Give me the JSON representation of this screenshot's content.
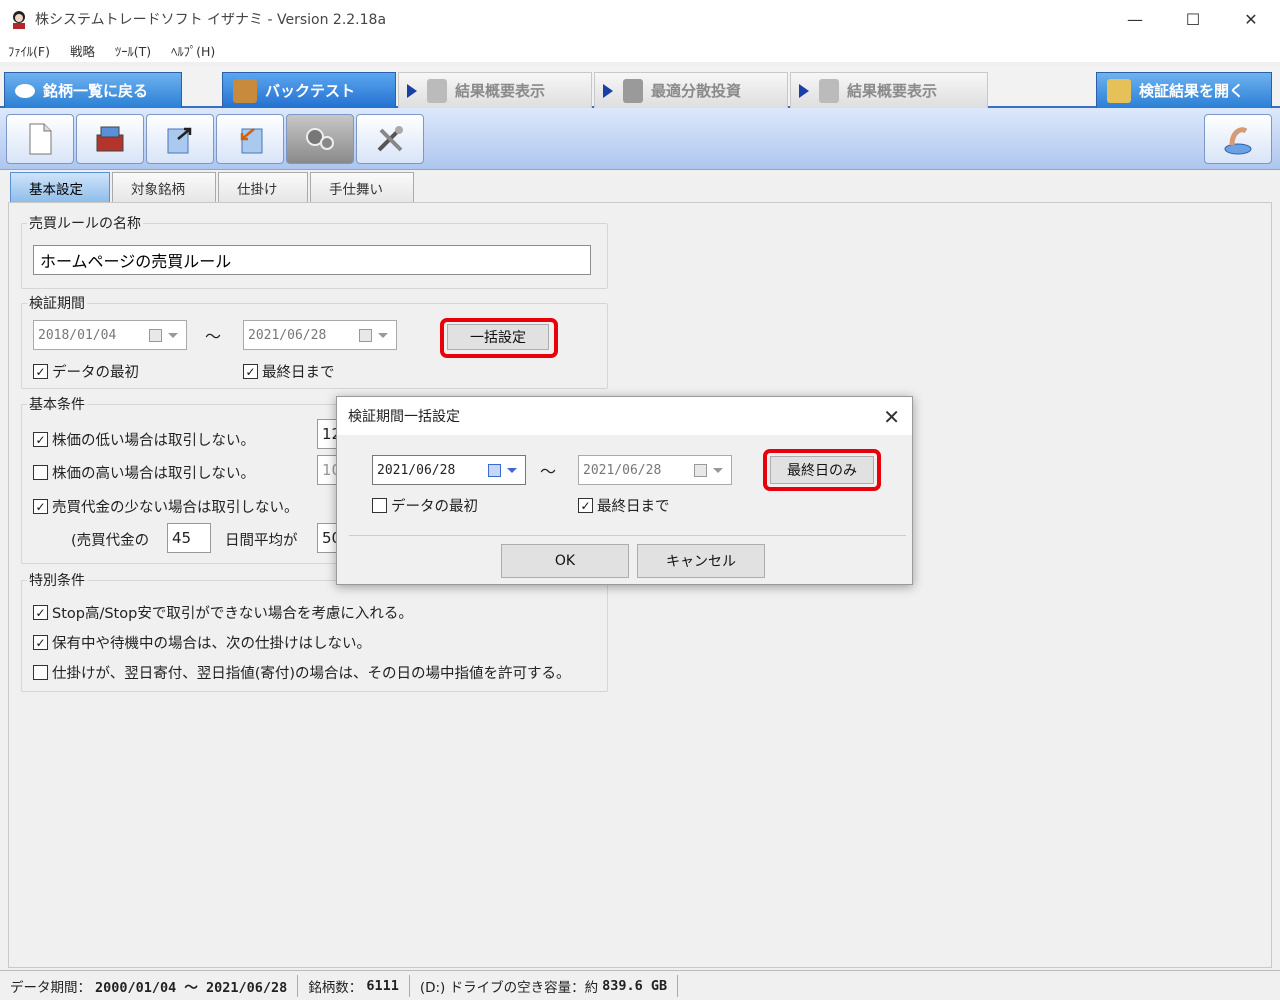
{
  "window": {
    "title": "株システムトレードソフト イザナミ - Version 2.2.18a",
    "controls": {
      "minimize": "—",
      "maximize": "☐",
      "close": "✕"
    }
  },
  "menu": [
    "ﾌｧｲﾙ(F)",
    "戦略",
    "ﾂｰﾙ(T)",
    "ﾍﾙﾌﾟ(H)"
  ],
  "nav": {
    "back": "銘柄一覧に戻る",
    "backtest": "バックテスト",
    "summary1": "結果概要表示",
    "optimal": "最適分散投資",
    "summary2": "結果概要表示",
    "open_results": "検証結果を開く"
  },
  "subtabs": [
    "基本設定",
    "対象銘柄",
    "仕掛け",
    "手仕舞い"
  ],
  "rule_name": {
    "label": "売買ルールの名称",
    "value": "ホームページの売買ルール"
  },
  "period": {
    "label": "検証期間",
    "start": "2018/01/04",
    "tilde": "〜",
    "end": "2021/06/28",
    "bulk_button": "一括設定",
    "data_first": "データの最初",
    "until_last": "最終日まで"
  },
  "basic": {
    "label": "基本条件",
    "low_price": "株価の低い場合は取引しない。",
    "high_price": "株価の高い場合は取引しない。",
    "low_volume": "売買代金の少ない場合は取引しない。",
    "low_price_val": "12",
    "high_price_val": "10",
    "avg_prefix": "(売買代金の",
    "days": "45",
    "avg_suffix": "日間平均が",
    "avg_val": "50"
  },
  "special": {
    "label": "特別条件",
    "stop": "Stop高/Stop安で取引ができない場合を考慮に入れる。",
    "holding": "保有中や待機中の場合は、次の仕掛けはしない。",
    "intraday": "仕掛けが、翌日寄付、翌日指値(寄付)の場合は、その日の場中指値を許可する。"
  },
  "dialog": {
    "title": "検証期間一括設定",
    "start": "2021/06/28",
    "tilde": "〜",
    "end": "2021/06/28",
    "last_only": "最終日のみ",
    "data_first": "データの最初",
    "until_last": "最終日まで",
    "ok": "OK",
    "cancel": "キャンセル"
  },
  "status": {
    "period_label": "データ期間：",
    "period_value": "2000/01/04 〜 2021/06/28",
    "count_label": "銘柄数：",
    "count_value": "6111",
    "drive_label": "(D:) ドライブの空き容量：約",
    "drive_value": "839.6 GB"
  }
}
